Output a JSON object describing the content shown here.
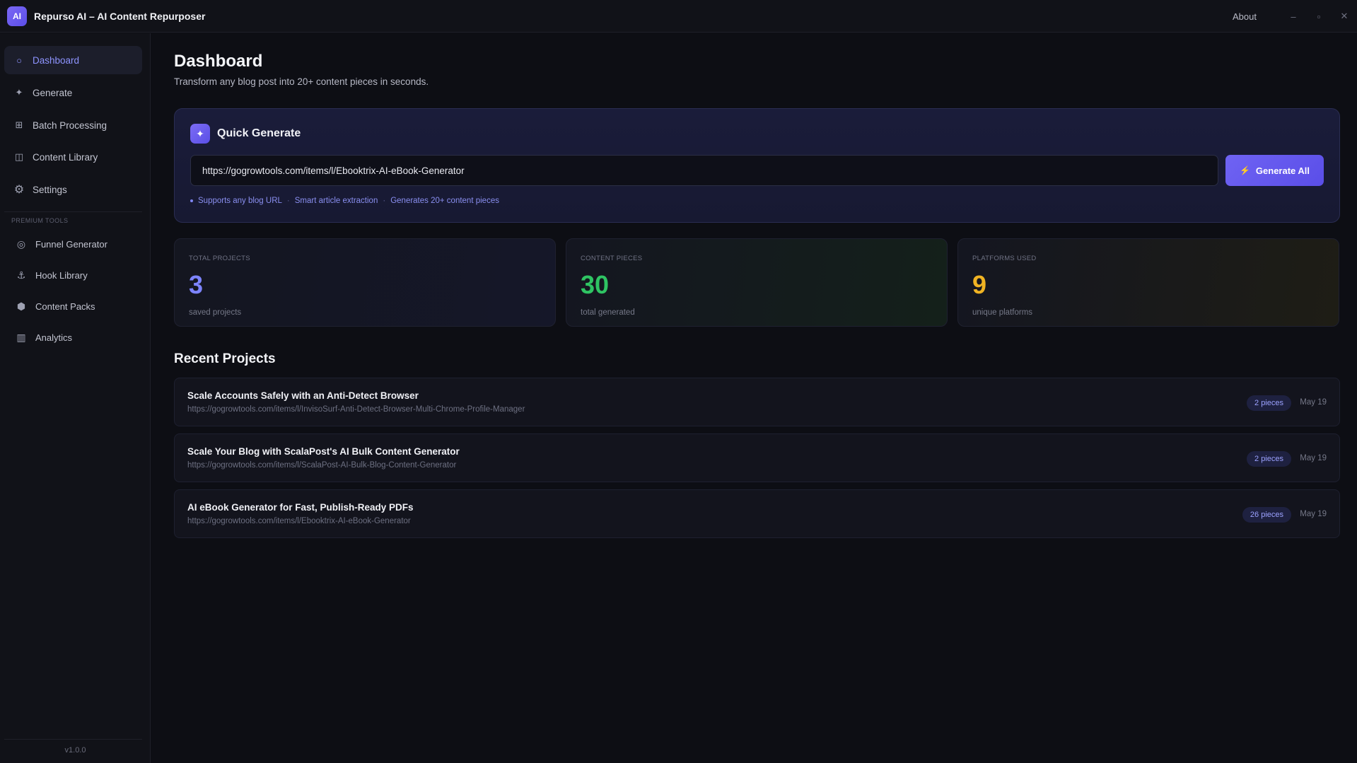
{
  "app": {
    "logo": "AI",
    "title": "Repurso AI – AI Content Repurposer"
  },
  "titlebar": {
    "about": "About",
    "minimize": "–",
    "maximize": "▫",
    "close": "✕"
  },
  "sidebar": {
    "items": [
      {
        "label": "Dashboard",
        "icon": "circle-outline-icon",
        "glyph": "○"
      },
      {
        "label": "Generate",
        "icon": "sparkle-icon",
        "glyph": "✦"
      },
      {
        "label": "Batch Processing",
        "icon": "grid-icon",
        "glyph": "⊞"
      },
      {
        "label": "Content Library",
        "icon": "book-icon",
        "glyph": "◫"
      },
      {
        "label": "Settings",
        "icon": "gear-icon",
        "glyph": "⚙"
      }
    ],
    "section_label": "PREMIUM TOOLS",
    "premium_items": [
      {
        "label": "Funnel Generator",
        "icon": "target-icon",
        "glyph": "◎"
      },
      {
        "label": "Hook Library",
        "icon": "anchor-icon",
        "glyph": "⚓"
      },
      {
        "label": "Content Packs",
        "icon": "package-icon",
        "glyph": "⬢"
      },
      {
        "label": "Analytics",
        "icon": "bar-chart-icon",
        "glyph": "▥"
      }
    ],
    "version": "v1.0.0"
  },
  "main": {
    "title": "Dashboard",
    "subtitle": "Transform any blog post into 20+ content pieces in seconds.",
    "quick_generate": {
      "icon_glyph": "✦",
      "title": "Quick Generate",
      "url_value": "https://gogrowtools.com/items/l/Ebooktrix-AI-eBook-Generator",
      "button_icon": "⚡",
      "button_label": "Generate All",
      "hints": [
        "Supports any blog URL",
        "Smart article extraction",
        "Generates 20+ content pieces"
      ],
      "hint_separator": "·"
    },
    "stats": [
      {
        "label": "TOTAL PROJECTS",
        "value": "3",
        "sub": "saved projects",
        "color": "#7d84ff"
      },
      {
        "label": "CONTENT PIECES",
        "value": "30",
        "sub": "total generated",
        "color": "#2fc463"
      },
      {
        "label": "PLATFORMS USED",
        "value": "9",
        "sub": "unique platforms",
        "color": "#f0b323"
      }
    ],
    "recent_title": "Recent Projects",
    "projects": [
      {
        "title": "Scale Accounts Safely with an Anti-Detect Browser",
        "url": "https://gogrowtools.com/items/l/InvisoSurf-Anti-Detect-Browser-Multi-Chrome-Profile-Manager",
        "pieces": "2 pieces",
        "date": "May 19"
      },
      {
        "title": "Scale Your Blog with ScalaPost's AI Bulk Content Generator",
        "url": "https://gogrowtools.com/items/l/ScalaPost-AI-Bulk-Blog-Content-Generator",
        "pieces": "2 pieces",
        "date": "May 19"
      },
      {
        "title": "AI eBook Generator for Fast, Publish-Ready PDFs",
        "url": "https://gogrowtools.com/items/l/Ebooktrix-AI-eBook-Generator",
        "pieces": "26 pieces",
        "date": "May 19"
      }
    ]
  }
}
